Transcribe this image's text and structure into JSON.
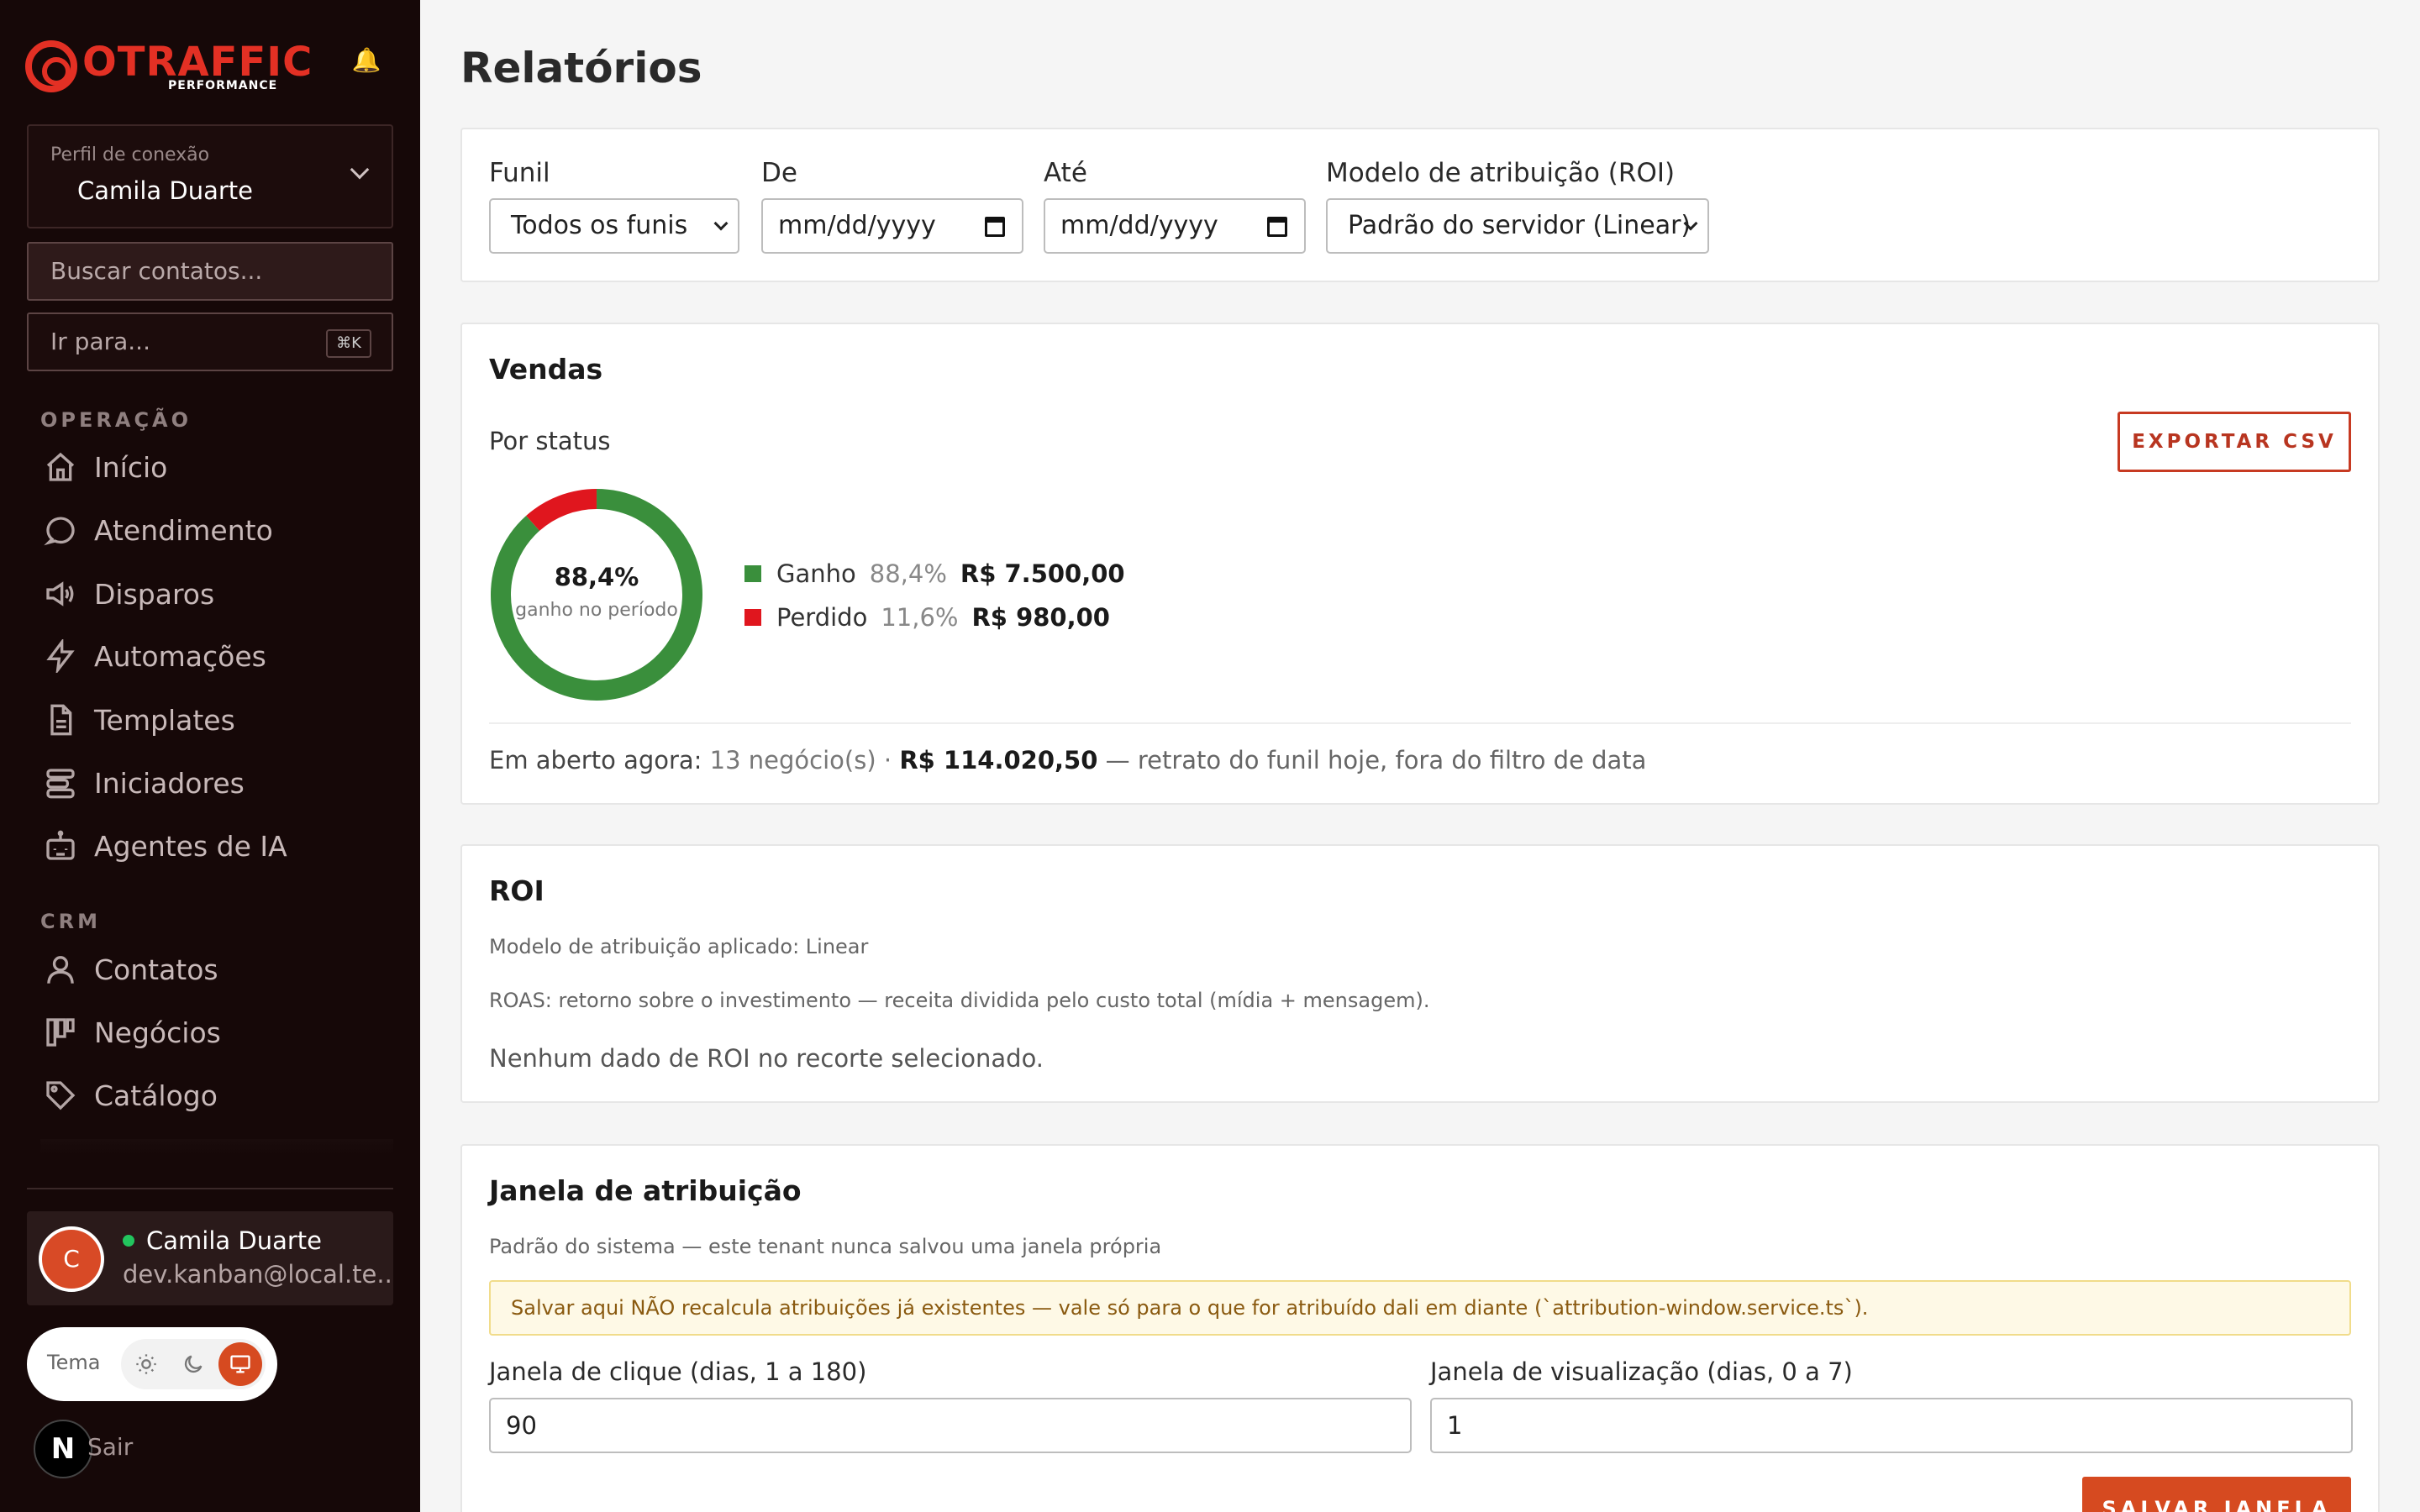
{
  "app": {
    "logo_text": "OTRAFFIC",
    "logo_subtext": "PERFORMANCE"
  },
  "sidebar": {
    "profile_label": "Perfil de conexão",
    "profile_value": "Camila Duarte",
    "search_placeholder": "Buscar contatos...",
    "goto_placeholder": "Ir para...",
    "goto_shortcut": "⌘K",
    "sections": [
      {
        "label": "OPERAÇÃO",
        "items": [
          {
            "label": "Início",
            "icon": "home-icon"
          },
          {
            "label": "Atendimento",
            "icon": "chat-bubble-icon"
          },
          {
            "label": "Disparos",
            "icon": "megaphone-icon"
          },
          {
            "label": "Automações",
            "icon": "lightning-icon"
          },
          {
            "label": "Templates",
            "icon": "document-icon"
          },
          {
            "label": "Iniciadores",
            "icon": "stack-icon"
          },
          {
            "label": "Agentes de IA",
            "icon": "robot-icon"
          }
        ]
      },
      {
        "label": "CRM",
        "items": [
          {
            "label": "Contatos",
            "icon": "user-icon"
          },
          {
            "label": "Negócios",
            "icon": "kanban-icon"
          },
          {
            "label": "Catálogo",
            "icon": "tag-icon"
          }
        ]
      }
    ],
    "user": {
      "initial": "C",
      "name": "Camila Duarte",
      "email": "dev.kanban@local.te..."
    },
    "theme_label": "Tema",
    "theme_active": "system",
    "next_badge": "N",
    "logout_label": "Sair"
  },
  "page": {
    "title": "Relatórios"
  },
  "filters": {
    "funnel_label": "Funil",
    "funnel_value": "Todos os funis",
    "from_label": "De",
    "from_value": "mm/dd/yyyy",
    "to_label": "Até",
    "to_value": "mm/dd/yyyy",
    "model_label": "Modelo de atribuição (ROI)",
    "model_value": "Padrão do servidor (Linear)"
  },
  "sales": {
    "title": "Vendas",
    "subtitle": "Por status",
    "export_label": "EXPORTAR CSV",
    "donut_pct": "88,4%",
    "donut_sub": "ganho no período",
    "legend": [
      {
        "name": "Ganho",
        "pct": "88,4%",
        "amount": "R$ 7.500,00",
        "color": "#3a8f3c",
        "share": 0.884
      },
      {
        "name": "Perdido",
        "pct": "11,6%",
        "amount": "R$ 980,00",
        "color": "#e0161e",
        "share": 0.116
      }
    ],
    "open_prefix": "Em aberto agora:",
    "open_count": "13 negócio(s) ·",
    "open_amount": "R$ 114.020,50",
    "open_note": "— retrato do funil hoje, fora do filtro de data"
  },
  "roi": {
    "title": "ROI",
    "model_applied": "Modelo de atribuição aplicado: Linear",
    "roas_desc": "ROAS: retorno sobre o investimento — receita dividida pelo custo total (mídia + mensagem).",
    "empty": "Nenhum dado de ROI no recorte selecionado."
  },
  "window": {
    "title": "Janela de atribuição",
    "subtitle": "Padrão do sistema — este tenant nunca salvou uma janela própria",
    "warning": "Salvar aqui NÃO recalcula atribuições já existentes — vale só para o que for atribuído dali em diante (`attribution-window.service.ts`).",
    "click_label": "Janela de clique (dias, 1 a 180)",
    "click_value": "90",
    "view_label": "Janela de visualização (dias, 0 a 7)",
    "view_value": "1",
    "save_label": "SALVAR JANELA"
  },
  "colors": {
    "sidebar_bg": "#160808",
    "accent": "#d64a20",
    "brand_red": "#e33024"
  }
}
